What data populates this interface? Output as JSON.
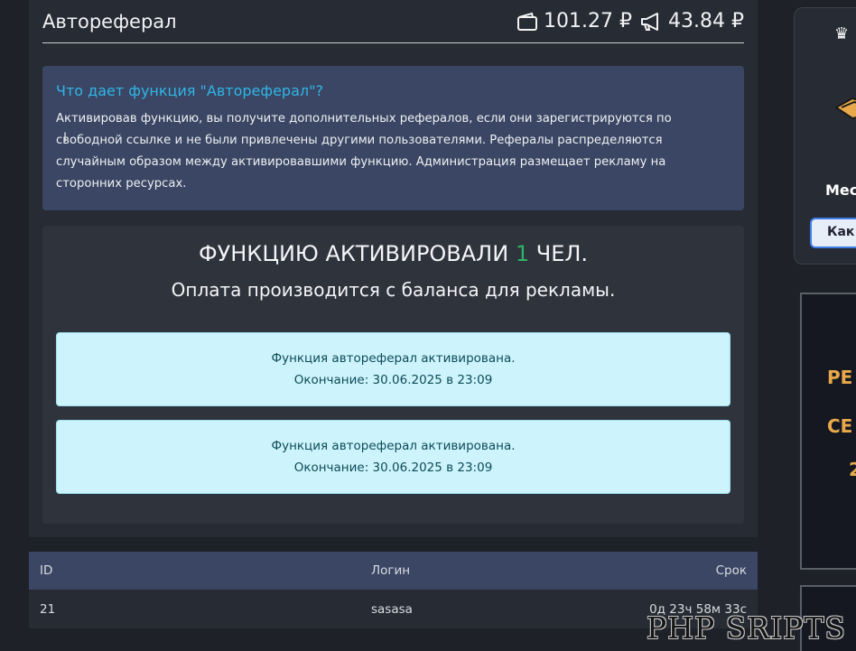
{
  "header": {
    "title": "Автореферал",
    "wallet_balance": "101.27 ₽",
    "ads_balance": "43.84 ₽"
  },
  "info": {
    "title": "Что дает функция \"Автореферал\"?",
    "text": "Активировав функцию, вы получите дополнительных рефералов, если они зарегистрируются по свободной ссылке и не были привлечены другими пользователями. Рефералы распределяются случайным образом между активировавшими функцию. Администрация размещает рекламу на сторонних ресурсах."
  },
  "stats": {
    "prefix": "ФУНКЦИЮ АКТИВИРОВАЛИ",
    "count": "1",
    "suffix": "ЧЕЛ.",
    "subtitle": "Оплата производится с баланса для рекламы."
  },
  "notices": [
    {
      "line1": "Функция автореферал активирована.",
      "line2": "Окончание: 30.06.2025 в 23:09"
    },
    {
      "line1": "Функция автореферал активирована.",
      "line2": "Окончание: 30.06.2025 в 23:09"
    }
  ],
  "table": {
    "columns": [
      "ID",
      "Логин",
      "Срок"
    ],
    "rows": [
      {
        "id": "21",
        "login": "sasasa",
        "term": "0д 23ч 58м 33с"
      }
    ]
  },
  "sidebar": {
    "card_label": "Мес",
    "card_button": "Как",
    "banner_lines": [
      "РЕ",
      "СЕ",
      "2"
    ]
  },
  "watermark": "PHP SRIPTS",
  "colors": {
    "accent_blue": "#31b5e6",
    "count_green": "#2eb267",
    "banner_gold": "#e9a94a"
  }
}
